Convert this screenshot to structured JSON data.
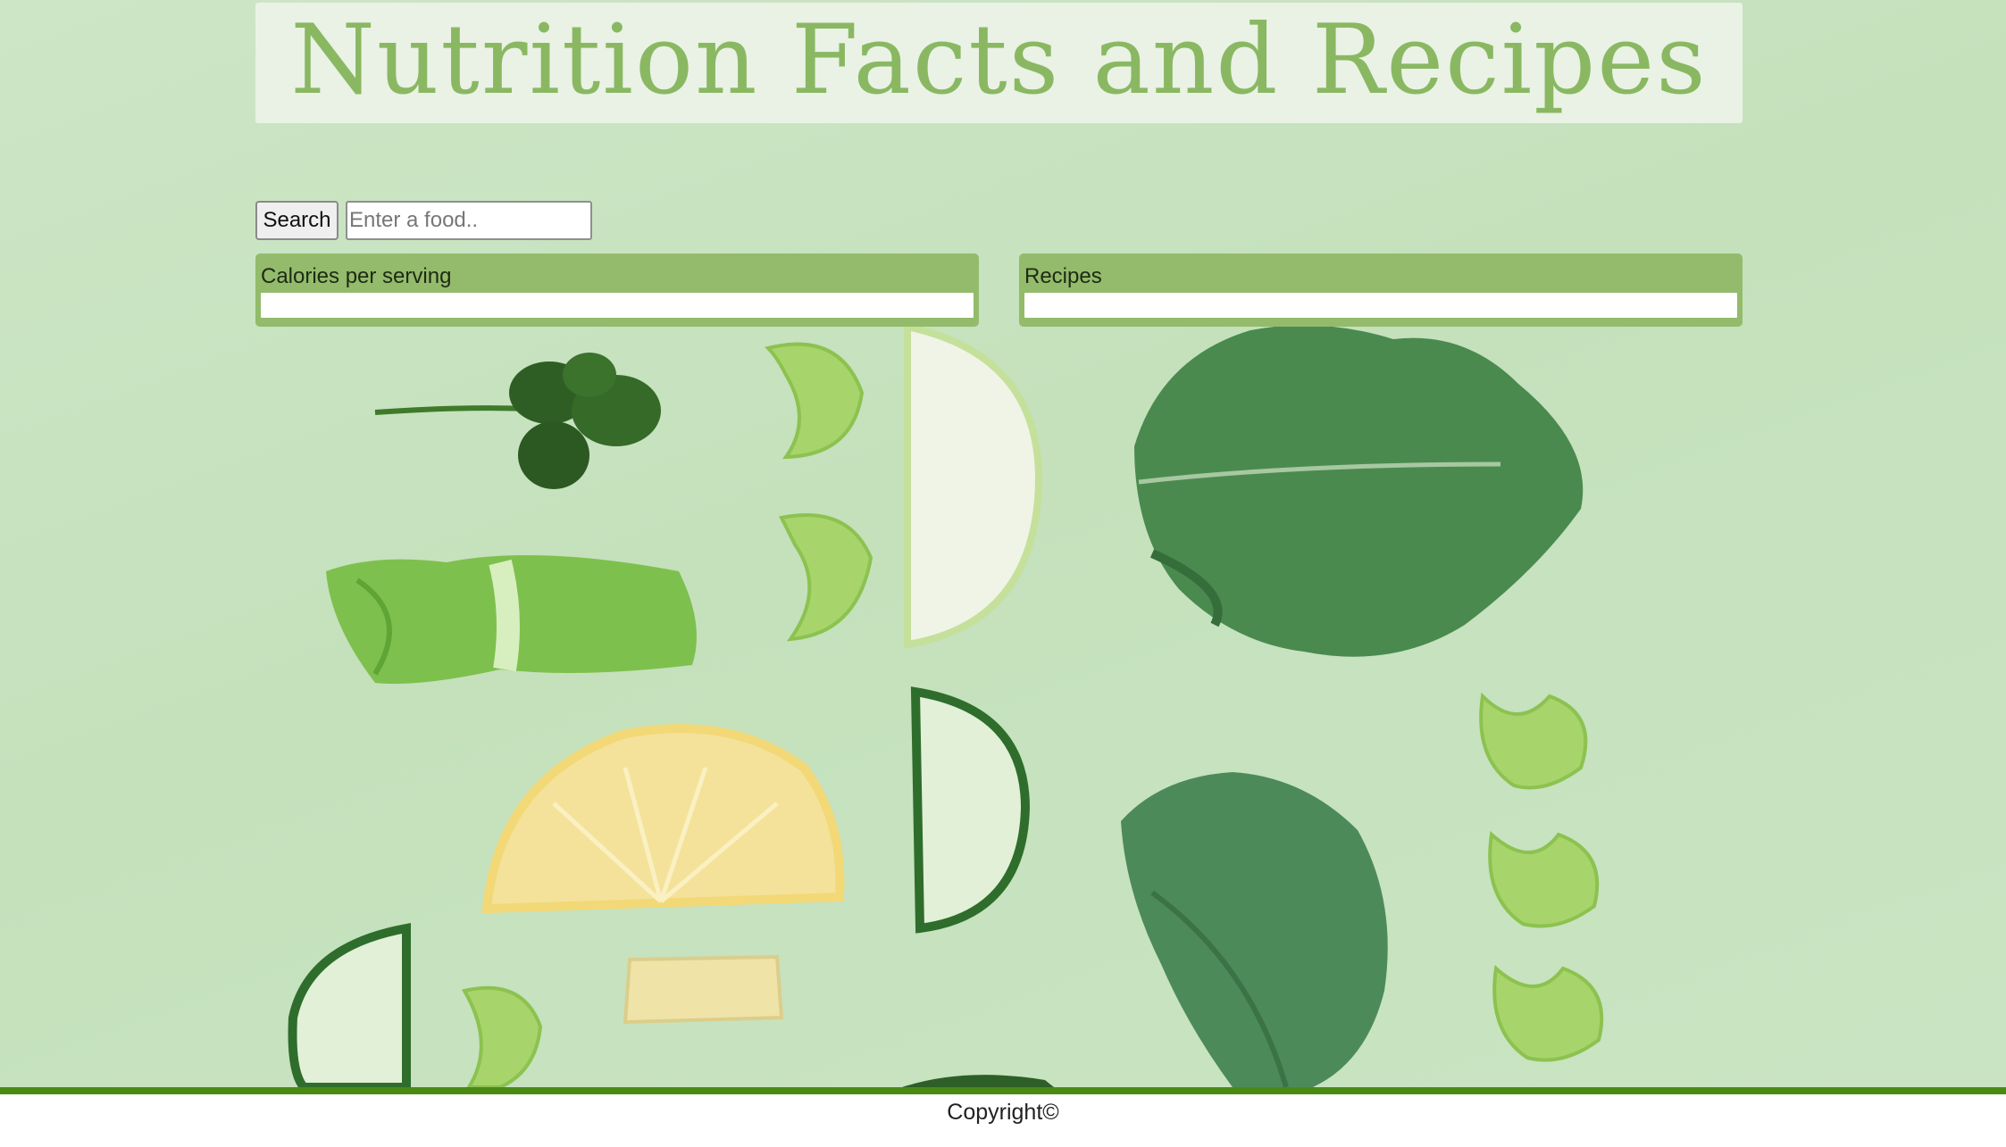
{
  "header": {
    "title": "Nutrition Facts and Recipes"
  },
  "search": {
    "button_label": "Search",
    "placeholder": "Enter a food.."
  },
  "panels": {
    "calories": {
      "title": "Calories per serving"
    },
    "recipes": {
      "title": "Recipes"
    }
  },
  "footer": {
    "copyright": "Copyright©"
  },
  "colors": {
    "title_text": "#8ab862",
    "panel_bg": "#93bb6b",
    "footer_line": "#4a8a14",
    "background": "#c6e2be"
  }
}
